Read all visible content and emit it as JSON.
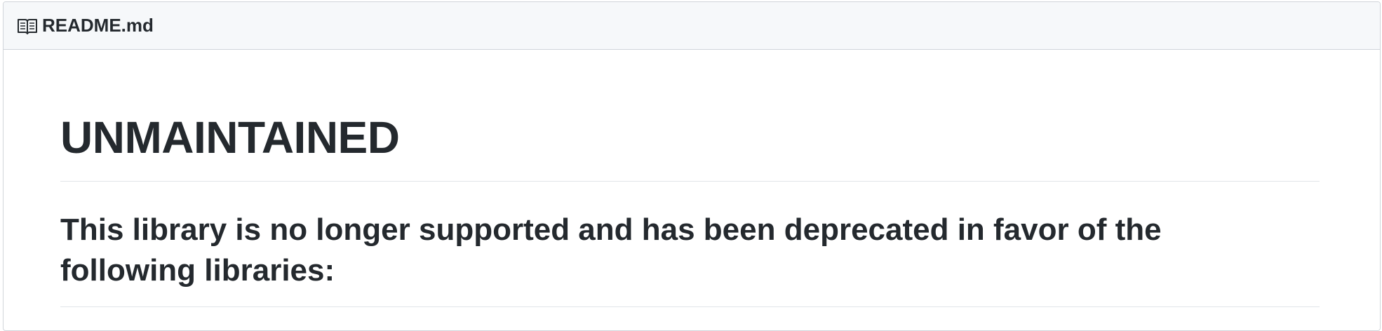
{
  "readme": {
    "file_icon": "book-icon",
    "file_name": "README.md",
    "heading": "UNMAINTAINED",
    "subheading": "This library is no longer supported and has been deprecated in favor of the following libraries:"
  },
  "colors": {
    "text": "#24292e",
    "header_bg": "#f6f8fa",
    "border": "#d1d5da",
    "divider": "#e1e4e8"
  }
}
